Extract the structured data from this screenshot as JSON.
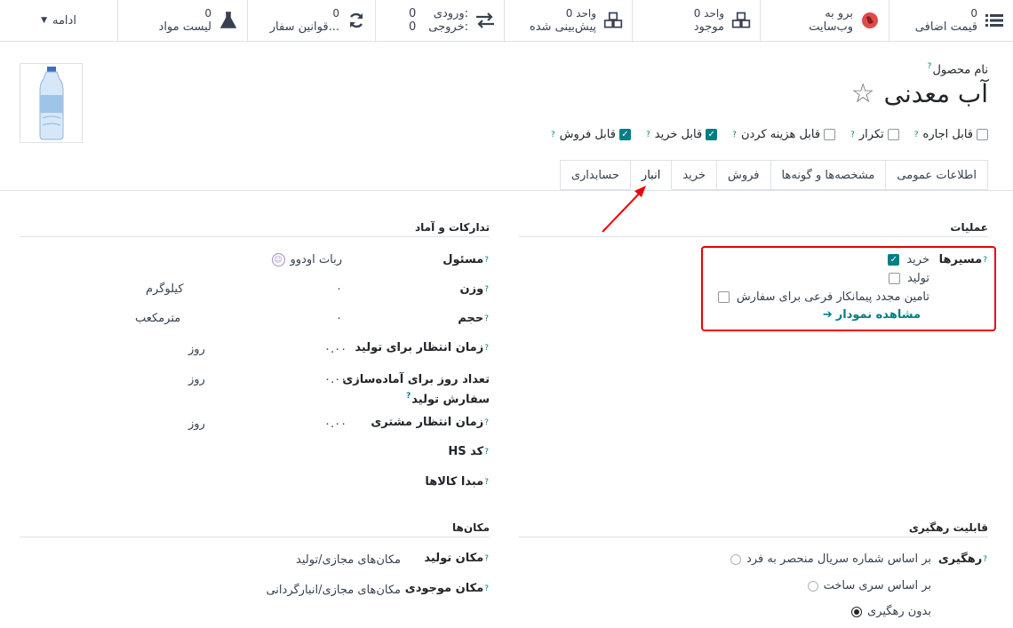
{
  "smart_buttons": {
    "extra_price": {
      "count": "0",
      "label": "قیمت اضافی"
    },
    "website": {
      "line1": "برو به",
      "line2": "وب‌سایت"
    },
    "on_hand": {
      "count": "0 واحد",
      "label": "موجود"
    },
    "forecasted": {
      "count": "0 واحد",
      "label": "پیش‌بینی شده"
    },
    "in_out": {
      "in_label": "ورودی:",
      "in_value": "0",
      "out_label": "خروجی:",
      "out_value": "0"
    },
    "order_rules": {
      "count": "0",
      "label": "قوانین سفار..."
    },
    "bom": {
      "count": "0",
      "label": "لیست مواد"
    },
    "more": "ادامه"
  },
  "header": {
    "product_name_label": "نام محصول",
    "product_name": "آب معدنی"
  },
  "flags": [
    {
      "label": "قابل فروش",
      "checked": true
    },
    {
      "label": "قابل خرید",
      "checked": true
    },
    {
      "label": "قابل هزینه کردن",
      "checked": false
    },
    {
      "label": "تکرار",
      "checked": false
    },
    {
      "label": "قابل اجاره",
      "checked": false
    }
  ],
  "tabs": [
    "اطلاعات عمومی",
    "مشخصه‌ها و گونه‌ها",
    "فروش",
    "خرید",
    "انبار",
    "حسابداری"
  ],
  "operations": {
    "title": "عملیات",
    "routes_label": "مسیرها",
    "routes": [
      {
        "label": "خرید",
        "checked": true
      },
      {
        "label": "تولید",
        "checked": false
      },
      {
        "label": "تامین مجدد پیمانکار فرعی برای سفارش",
        "checked": false
      }
    ],
    "view_diagram": "مشاهده نمودار"
  },
  "logistics": {
    "title": "تدارکات و آماد",
    "responsible_label": "مسئول",
    "responsible_value": "ربات اودوو",
    "weight_label": "وزن",
    "weight_value": "۰",
    "weight_unit": "کیلوگرم",
    "volume_label": "حجم",
    "volume_value": "۰",
    "volume_unit": "مترمکعب",
    "mfg_lead_label": "زمان انتظار برای تولید",
    "mfg_lead_value": "۰.۰۰",
    "mfg_lead_unit": "روز",
    "prep_days_label_1": "تعداد روز برای آماده‌سازی",
    "prep_days_label_2": "سفارش تولید",
    "prep_days_value": "۰.۰۰",
    "prep_days_unit": "روز",
    "customer_lead_label": "زمان انتظار مشتری",
    "customer_lead_value": "۰.۰۰",
    "customer_lead_unit": "روز",
    "hs_code_label": "کد HS",
    "origin_label": "مبدا کالاها"
  },
  "traceability": {
    "title": "قابلیت رهگیری",
    "tracking_label": "رهگیری",
    "options": [
      {
        "label": "بر اساس شماره سریال منحصر به فرد",
        "selected": false
      },
      {
        "label": "بر اساس سری ساخت",
        "selected": false
      },
      {
        "label": "بدون رهگیری",
        "selected": true
      }
    ]
  },
  "locations": {
    "title": "مکان‌ها",
    "production_label": "مکان تولید",
    "production_value": "مکان‌های مجازی/تولید",
    "inventory_label": "مکان موجودی",
    "inventory_value": "مکان‌های مجازی/انبارگردانی"
  },
  "colors": {
    "accent": "#017e84",
    "highlight": "#e00000"
  }
}
